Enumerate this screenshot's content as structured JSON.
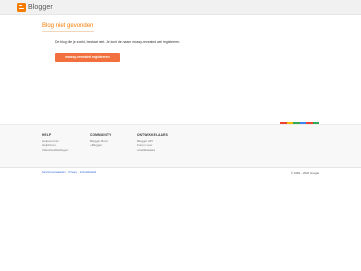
{
  "header": {
    "brand": "Blogger"
  },
  "main": {
    "title": "Blog niet gevonden",
    "message": "De blog die je zoekt, bestaat niet. Je kunt de naam mossy-revealed wel registreren.",
    "cta_label": "mossy-revealed registreren"
  },
  "footer": {
    "colorbar": [
      "#ea4335",
      "#fbbc05",
      "#34a853",
      "#4285f4",
      "#ea4335",
      "#34a853"
    ],
    "columns": [
      {
        "heading": "HELP",
        "links": [
          "Helpcentrum",
          "Helpforum",
          "Videohandleidingen"
        ]
      },
      {
        "heading": "COMMUNITY",
        "links": [
          "Blogger Buzz",
          "+Blogger"
        ]
      },
      {
        "heading": "ONTWIKKELAARS",
        "links": [
          "Blogger API",
          "Forum voor",
          "ontwikkelaars"
        ]
      }
    ],
    "legal": {
      "links": [
        "Servicevoorwaarden",
        "Privacy",
        "Inhoudsbeleid"
      ],
      "copyright": "© 1999 – 2020 Google"
    }
  }
}
